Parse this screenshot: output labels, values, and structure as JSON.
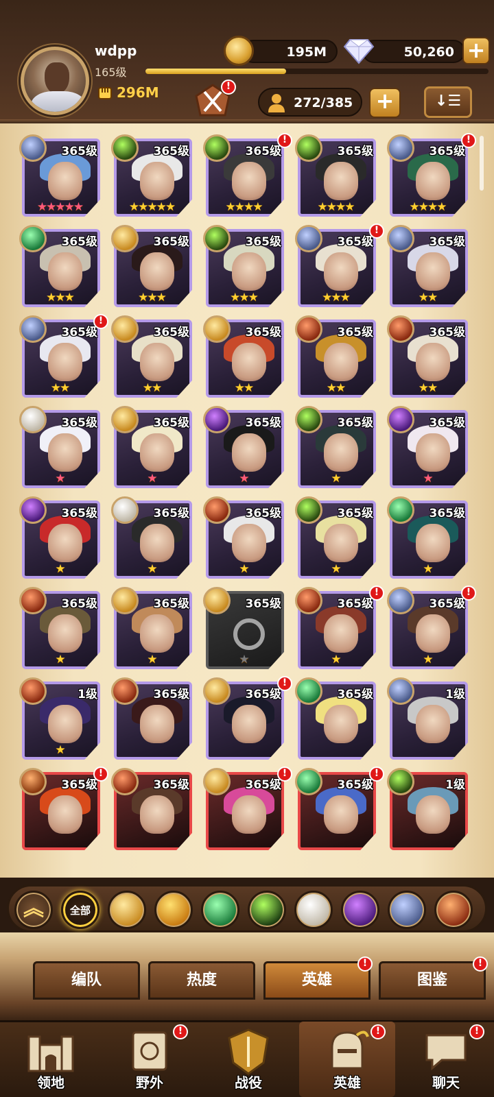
{
  "player": {
    "name": "wdpp",
    "level": "165级",
    "power": "296M",
    "xp_progress": 0.41
  },
  "resources": {
    "gold": "195M",
    "diamonds": "50,260",
    "plus": "+"
  },
  "hero_count": "272/385",
  "badge": "!",
  "sort_label": "↓☰",
  "heroes": [
    {
      "level": "365级",
      "stars": "★★★★★",
      "star_color": "pink",
      "faction": "dim",
      "alert": false,
      "frame": "purple"
    },
    {
      "level": "365级",
      "stars": "★★★★★",
      "star_color": "gold",
      "faction": "grave",
      "alert": false,
      "frame": "purple"
    },
    {
      "level": "365级",
      "stars": "★★★★",
      "star_color": "gold",
      "faction": "grave",
      "alert": true,
      "frame": "purple"
    },
    {
      "level": "365级",
      "stars": "★★★★",
      "star_color": "gold",
      "faction": "grave",
      "alert": false,
      "frame": "purple"
    },
    {
      "level": "365级",
      "stars": "★★★★",
      "star_color": "gold",
      "faction": "dim",
      "alert": true,
      "frame": "purple"
    },
    {
      "level": "365级",
      "stars": "★★★",
      "star_color": "gold",
      "faction": "wilder",
      "alert": false,
      "frame": "purple"
    },
    {
      "level": "365级",
      "stars": "★★★",
      "star_color": "gold",
      "faction": "light",
      "alert": false,
      "frame": "purple"
    },
    {
      "level": "365级",
      "stars": "★★★",
      "star_color": "gold",
      "faction": "grave",
      "alert": false,
      "frame": "purple"
    },
    {
      "level": "365级",
      "stars": "★★★",
      "star_color": "gold",
      "faction": "dim",
      "alert": true,
      "frame": "purple"
    },
    {
      "level": "365级",
      "stars": "★★",
      "star_color": "gold",
      "faction": "dim",
      "alert": false,
      "frame": "purple"
    },
    {
      "level": "365级",
      "stars": "★★",
      "star_color": "gold",
      "faction": "dim",
      "alert": true,
      "frame": "purple"
    },
    {
      "level": "365级",
      "stars": "★★",
      "star_color": "gold",
      "faction": "light",
      "alert": false,
      "frame": "purple"
    },
    {
      "level": "365级",
      "stars": "★★",
      "star_color": "gold",
      "faction": "light",
      "alert": false,
      "frame": "purple"
    },
    {
      "level": "365级",
      "stars": "★★",
      "star_color": "gold",
      "faction": "mauler",
      "alert": false,
      "frame": "purple"
    },
    {
      "level": "365级",
      "stars": "★★",
      "star_color": "gold",
      "faction": "mauler",
      "alert": false,
      "frame": "purple"
    },
    {
      "level": "365级",
      "stars": "★",
      "star_color": "pink",
      "faction": "celest",
      "alert": false,
      "frame": "purple"
    },
    {
      "level": "365级",
      "stars": "★",
      "star_color": "pink",
      "faction": "light",
      "alert": false,
      "frame": "purple"
    },
    {
      "level": "365级",
      "stars": "★",
      "star_color": "pink",
      "faction": "hypo",
      "alert": false,
      "frame": "purple"
    },
    {
      "level": "365级",
      "stars": "★",
      "star_color": "gold",
      "faction": "grave",
      "alert": false,
      "frame": "purple"
    },
    {
      "level": "365级",
      "stars": "★",
      "star_color": "pink",
      "faction": "hypo",
      "alert": false,
      "frame": "purple"
    },
    {
      "level": "365级",
      "stars": "★",
      "star_color": "gold",
      "faction": "hypo",
      "alert": false,
      "frame": "purple"
    },
    {
      "level": "365级",
      "stars": "★",
      "star_color": "gold",
      "faction": "celest",
      "alert": false,
      "frame": "purple"
    },
    {
      "level": "365级",
      "stars": "★",
      "star_color": "gold",
      "faction": "mauler",
      "alert": false,
      "frame": "purple"
    },
    {
      "level": "365级",
      "stars": "★",
      "star_color": "gold",
      "faction": "grave",
      "alert": false,
      "frame": "purple"
    },
    {
      "level": "365级",
      "stars": "★",
      "star_color": "gold",
      "faction": "wilder",
      "alert": false,
      "frame": "purple"
    },
    {
      "level": "365级",
      "stars": "★",
      "star_color": "gold",
      "faction": "mauler",
      "alert": false,
      "frame": "purple"
    },
    {
      "level": "365级",
      "stars": "★",
      "star_color": "gold",
      "faction": "light",
      "alert": false,
      "frame": "purple"
    },
    {
      "level": "365级",
      "stars": "★",
      "star_color": "grey",
      "faction": "light",
      "alert": false,
      "frame": "grey"
    },
    {
      "level": "365级",
      "stars": "★",
      "star_color": "gold",
      "faction": "mauler",
      "alert": true,
      "frame": "purple"
    },
    {
      "level": "365级",
      "stars": "★",
      "star_color": "gold",
      "faction": "dim",
      "alert": true,
      "frame": "purple"
    },
    {
      "level": "1级",
      "stars": "★",
      "star_color": "gold",
      "faction": "mauler",
      "alert": false,
      "frame": "purple"
    },
    {
      "level": "365级",
      "stars": "",
      "star_color": "gold",
      "faction": "mauler",
      "alert": false,
      "frame": "purple"
    },
    {
      "level": "365级",
      "stars": "",
      "star_color": "gold",
      "faction": "light",
      "alert": true,
      "frame": "purple"
    },
    {
      "level": "365级",
      "stars": "",
      "star_color": "gold",
      "faction": "wilder",
      "alert": false,
      "frame": "purple"
    },
    {
      "level": "1级",
      "stars": "",
      "star_color": "gold",
      "faction": "dim",
      "alert": false,
      "frame": "purple"
    },
    {
      "level": "365级",
      "stars": "",
      "star_color": "gold",
      "faction": "drag",
      "alert": true,
      "frame": "red"
    },
    {
      "level": "365级",
      "stars": "",
      "star_color": "gold",
      "faction": "mauler",
      "alert": false,
      "frame": "red"
    },
    {
      "level": "365级",
      "stars": "",
      "star_color": "gold",
      "faction": "light",
      "alert": true,
      "frame": "red"
    },
    {
      "level": "365级",
      "stars": "",
      "star_color": "gold",
      "faction": "wilder",
      "alert": true,
      "frame": "red"
    },
    {
      "level": "1级",
      "stars": "",
      "star_color": "gold",
      "faction": "grave",
      "alert": false,
      "frame": "red"
    }
  ],
  "filters": {
    "all_label": "全部",
    "items": [
      "light",
      "mauler",
      "wilder",
      "grave",
      "celest",
      "hypo",
      "dim",
      "drag"
    ]
  },
  "subtabs": [
    {
      "label": "编队",
      "active": false,
      "alert": false
    },
    {
      "label": "热度",
      "active": false,
      "alert": false
    },
    {
      "label": "英雄",
      "active": true,
      "alert": true
    },
    {
      "label": "图鉴",
      "active": false,
      "alert": true
    }
  ],
  "nav": [
    {
      "label": "领地",
      "alert": false,
      "active": false,
      "icon": "castle-icon"
    },
    {
      "label": "野外",
      "alert": true,
      "active": false,
      "icon": "scroll-map-icon"
    },
    {
      "label": "战役",
      "alert": false,
      "active": false,
      "icon": "battle-shield-icon"
    },
    {
      "label": "英雄",
      "alert": true,
      "active": true,
      "icon": "helmet-icon"
    },
    {
      "label": "聊天",
      "alert": true,
      "active": false,
      "icon": "chat-bubble-icon"
    }
  ],
  "colors": {
    "accent_gold": "#ffd04a",
    "alert_red": "#e01818",
    "frame_purple": "#b49ae8",
    "frame_red": "#e84848"
  }
}
